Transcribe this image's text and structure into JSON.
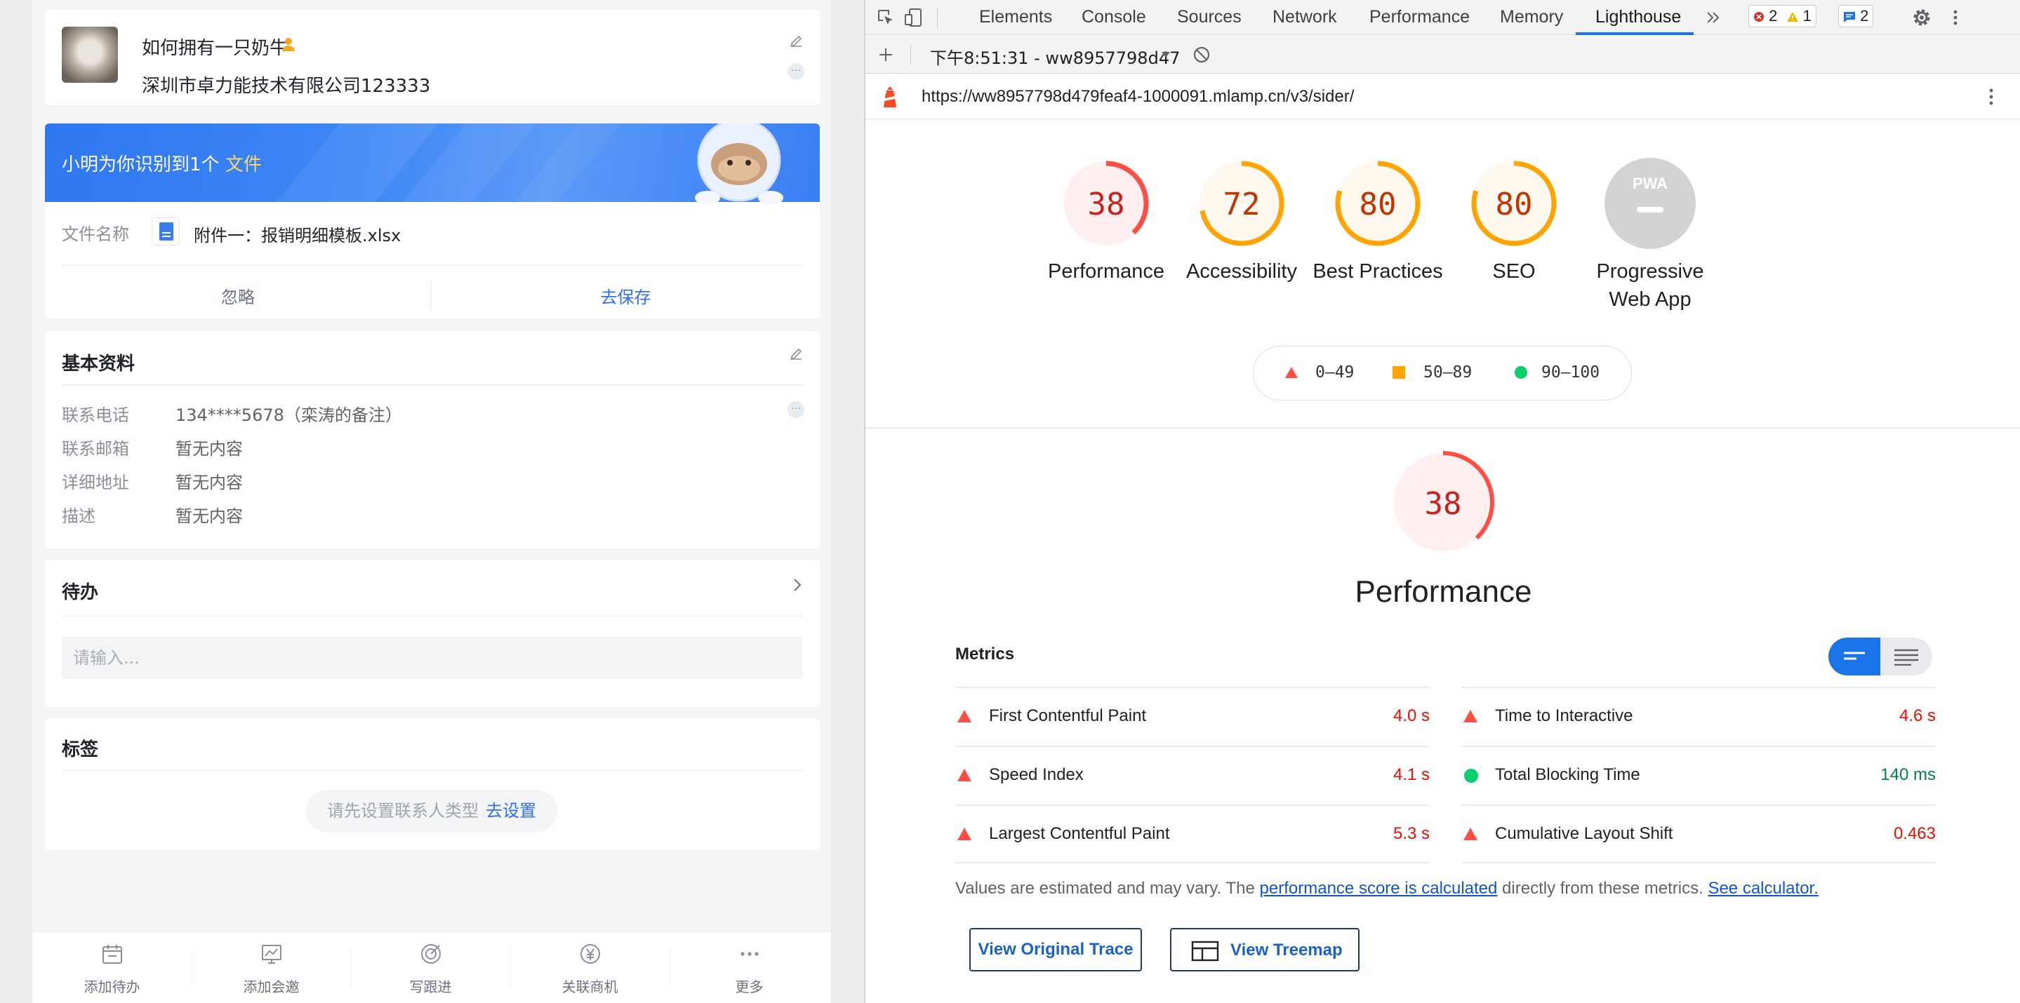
{
  "profile": {
    "name": "如何拥有一只奶牛",
    "company": "深圳市卓力能技术有限公司123333"
  },
  "detect": {
    "prefix": "小明为你识别到1个",
    "highlight": "文件",
    "file_label": "文件名称",
    "file_name": "附件一：报销明细模板.xlsx",
    "ignore": "忽略",
    "save": "去保存"
  },
  "basic": {
    "title": "基本资料",
    "rows": [
      {
        "key": "联系电话",
        "value": "134****5678（栾涛的备注）"
      },
      {
        "key": "联系邮箱",
        "value": "暂无内容"
      },
      {
        "key": "详细地址",
        "value": "暂无内容"
      },
      {
        "key": "描述",
        "value": "暂无内容"
      }
    ]
  },
  "todo": {
    "title": "待办",
    "placeholder": "请输入..."
  },
  "tags": {
    "title": "标签",
    "hint": "请先设置联系人类型",
    "action": "去设置"
  },
  "bottombar": {
    "items": [
      {
        "label": "添加待办",
        "icon": "calendar-icon"
      },
      {
        "label": "添加会邀",
        "icon": "meeting-invite-icon"
      },
      {
        "label": "写跟进",
        "icon": "target-icon"
      },
      {
        "label": "关联商机",
        "icon": "yuan-coin-icon"
      },
      {
        "label": "更多",
        "icon": "more-dots-icon"
      }
    ]
  },
  "devtools": {
    "tabs": [
      "Elements",
      "Console",
      "Sources",
      "Network",
      "Performance",
      "Memory",
      "Lighthouse"
    ],
    "active_tab": "Lighthouse",
    "errors": "2",
    "warnings": "1",
    "messages": "2",
    "run_label": "下午8:51:31 - ww8957798d47",
    "url": "https://ww8957798d479feaf4-1000091.mlamp.cn/v3/sider/"
  },
  "lighthouse": {
    "categories": [
      {
        "label": "Performance",
        "score": 38,
        "rating": "fail"
      },
      {
        "label": "Accessibility",
        "score": 72,
        "rating": "average"
      },
      {
        "label": "Best Practices",
        "score": 80,
        "rating": "average"
      },
      {
        "label": "SEO",
        "score": 80,
        "rating": "average"
      },
      {
        "label": "Progressive Web App",
        "score": null,
        "rating": "na",
        "badge": "PWA"
      }
    ],
    "legend": [
      "0–49",
      "50–89",
      "90–100"
    ],
    "colors": {
      "fail": "#ff4e42",
      "average": "#ffa400",
      "pass": "#0cce6b",
      "na": "#cccccc"
    },
    "big_score": 38,
    "big_title": "Performance",
    "metrics_label": "Metrics",
    "metrics": [
      {
        "name": "First Contentful Paint",
        "value": "4.0 s",
        "rating": "fail"
      },
      {
        "name": "Time to Interactive",
        "value": "4.6 s",
        "rating": "fail"
      },
      {
        "name": "Speed Index",
        "value": "4.1 s",
        "rating": "fail"
      },
      {
        "name": "Total Blocking Time",
        "value": "140 ms",
        "rating": "pass"
      },
      {
        "name": "Largest Contentful Paint",
        "value": "5.3 s",
        "rating": "fail"
      },
      {
        "name": "Cumulative Layout Shift",
        "value": "0.463",
        "rating": "fail"
      }
    ],
    "note_prefix": "Values are estimated and may vary. The ",
    "note_link1": "performance score is calculated",
    "note_mid": " directly from these metrics. ",
    "note_link2": "See calculator.",
    "btn_trace": "View Original Trace",
    "btn_treemap": "View Treemap"
  }
}
